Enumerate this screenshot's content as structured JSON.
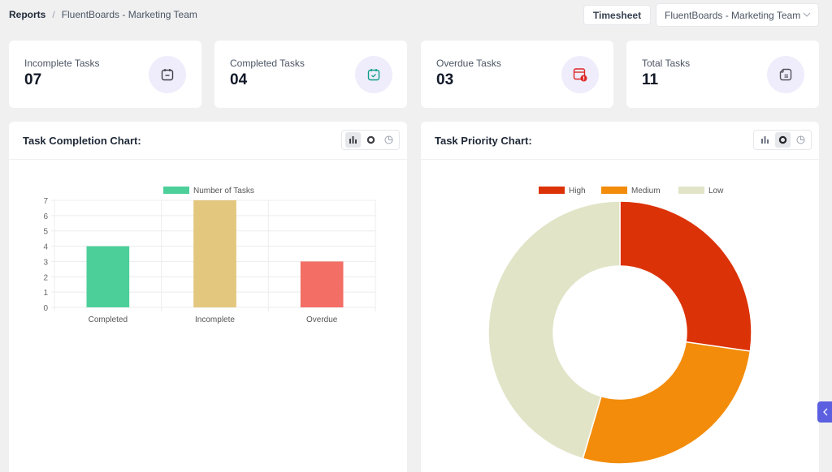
{
  "breadcrumb": {
    "root": "Reports",
    "separator": "/",
    "current": "FluentBoards - Marketing Team"
  },
  "toolbar": {
    "timesheet_label": "Timesheet",
    "board_select_value": "FluentBoards - Marketing Team"
  },
  "stats": [
    {
      "label": "Incomplete Tasks",
      "value": "07",
      "icon": "calendar-minus-icon",
      "icon_color": "#3f3f46"
    },
    {
      "label": "Completed Tasks",
      "value": "04",
      "icon": "calendar-check-icon",
      "icon_color": "#0f9d8a"
    },
    {
      "label": "Overdue Tasks",
      "value": "03",
      "icon": "calendar-alert-icon",
      "icon_color": "#dc2626"
    },
    {
      "label": "Total Tasks",
      "value": "11",
      "icon": "document-icon",
      "icon_color": "#52525b"
    }
  ],
  "panels": {
    "completion": {
      "title": "Task Completion Chart:",
      "active_view": "bar"
    },
    "priority": {
      "title": "Task Priority Chart:",
      "active_view": "doughnut"
    }
  },
  "chart_data": [
    {
      "type": "bar",
      "title": "Task Completion Chart:",
      "legend": [
        "Number of Tasks"
      ],
      "legend_position": "top",
      "categories": [
        "Completed",
        "Incomplete",
        "Overdue"
      ],
      "values": [
        4,
        7,
        3
      ],
      "colors": [
        "#4dcf9a",
        "#e3c77e",
        "#f36f66"
      ],
      "legend_color": "#4dcf9a",
      "ylim": [
        0,
        7
      ],
      "yticks": [
        0,
        1,
        2,
        3,
        4,
        5,
        6,
        7
      ],
      "xlabel": "",
      "ylabel": "",
      "grid": true
    },
    {
      "type": "pie",
      "variant": "doughnut",
      "title": "Task Priority Chart:",
      "legend_position": "top",
      "labels": [
        "High",
        "Medium",
        "Low"
      ],
      "values": [
        3,
        3,
        5
      ],
      "colors": [
        "#dc3208",
        "#f28c0a",
        "#e1e4c7"
      ]
    }
  ]
}
